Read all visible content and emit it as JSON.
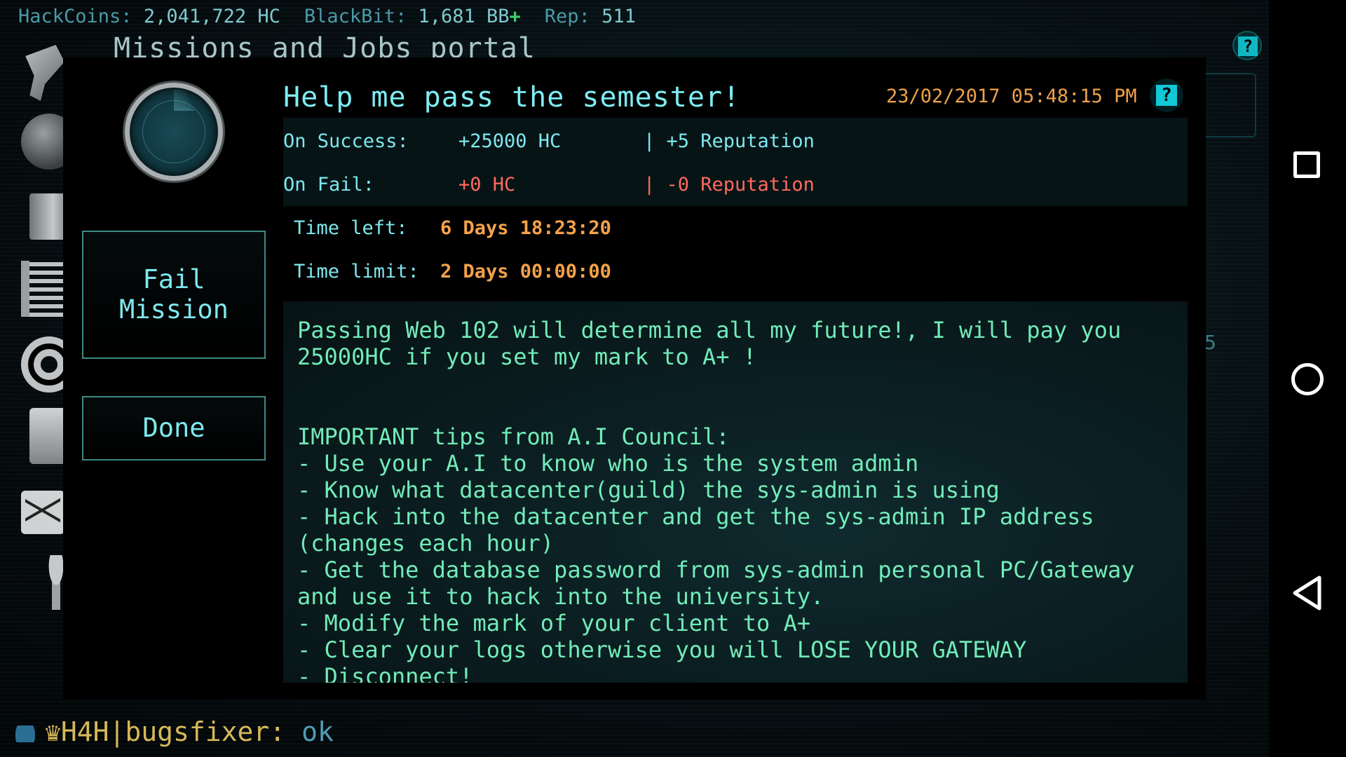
{
  "stats": {
    "hackcoins_label": "HackCoins:",
    "hackcoins_value": "2,041,722 HC",
    "blackbit_label": "BlackBit:",
    "blackbit_value": "1,681 BB",
    "blackbit_add": "+",
    "rep_label": "Rep:",
    "rep_value": "511"
  },
  "portal": {
    "title": "Missions and Jobs portal"
  },
  "sidebar_icons": [
    "tool-icon",
    "globe-icon",
    "server-icon",
    "chip-icon",
    "target-icon",
    "printer-icon",
    "mail-icon",
    "trophy-icon"
  ],
  "background": {
    "side_number": "5",
    "help_glyph": "?"
  },
  "mission": {
    "title": "Help me pass the semester!",
    "date": "23/02/2017 05:48:15 PM",
    "help_glyph": "?",
    "fail_button": "Fail Mission",
    "done_button": "Done",
    "on_success": {
      "label": "On Success:",
      "amount": "+25000 HC",
      "reputation": "| +5 Reputation"
    },
    "on_fail": {
      "label": "On Fail:",
      "amount": "+0 HC",
      "reputation": "| -0 Reputation"
    },
    "time_left": {
      "label": "Time left:",
      "value": "6 Days 18:23:20"
    },
    "time_limit": {
      "label": "Time limit:",
      "value": "2 Days 00:00:00"
    },
    "description": "Passing Web 102 will determine all my future!, I will pay you\n25000HC if you set my mark to A+ !\n\n\nIMPORTANT tips from A.I Council:\n- Use your A.I to know who is the system admin\n- Know what datacenter(guild) the sys-admin is using\n- Hack into the datacenter and get the sys-admin IP address\n(changes each hour)\n- Get the database password from sys-admin personal PC/Gateway\nand use it to hack into the university.\n- Modify the mark of your client to A+\n- Clear your logs otherwise you will LOSE YOUR GATEWAY\n- Disconnect!"
  },
  "chat": {
    "crown": "♛",
    "username": "H4H|bugsfixer:",
    "message": " ok"
  },
  "navbar": {
    "recent_icon": "square-icon",
    "home_icon": "circle-icon",
    "back_icon": "triangle-back-icon"
  },
  "colors": {
    "accent": "#7ee8ee",
    "success": "#7ee8ee",
    "fail": "#ff6a5e",
    "time": "#f5a24a",
    "description": "#72ecb8"
  }
}
